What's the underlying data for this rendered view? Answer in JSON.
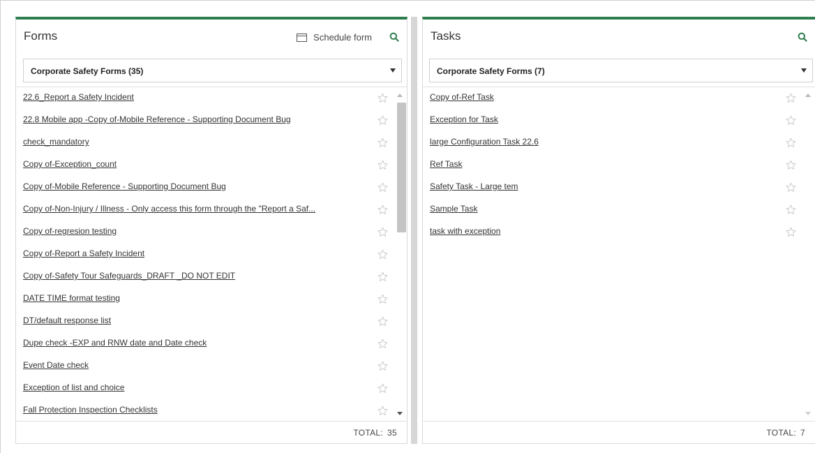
{
  "forms_panel": {
    "title": "Forms",
    "schedule_label": "Schedule form",
    "search_icon": "search-icon",
    "dropdown_selected": "Corporate Safety Forms (35)",
    "items": [
      "22.6_Report a Safety Incident",
      "22.8 Mobile app -Copy of-Mobile Reference - Supporting Document Bug",
      "check_mandatory",
      "Copy of-Exception_count",
      "Copy of-Mobile Reference - Supporting Document Bug",
      "Copy of-Non-Injury / Illness - Only access this form through the \"Report a Saf...",
      "Copy of-regresion testing",
      "Copy of-Report a Safety Incident",
      "Copy of-Safety Tour Safeguards_DRAFT _DO NOT EDIT",
      "DATE TIME format testing",
      "DT/default response list",
      "Dupe check -EXP and RNW date and Date check",
      "Event Date check",
      "Exception of list and choice",
      "Fall Protection Inspection Checklists"
    ],
    "total_label": "TOTAL:",
    "total_value": "35"
  },
  "tasks_panel": {
    "title": "Tasks",
    "search_icon": "search-icon",
    "dropdown_selected": "Corporate Safety Forms (7)",
    "items": [
      "Copy of-Ref Task",
      "Exception for Task",
      "large Configuration Task 22.6",
      "Ref Task",
      "Safety Task - Large tem",
      "Sample Task",
      "task with exception"
    ],
    "total_label": "TOTAL:",
    "total_value": "7"
  },
  "colors": {
    "accent_green": "#2e7d4f",
    "search_icon_green": "#2e7d4f",
    "star_outline": "#c8c8c8"
  }
}
